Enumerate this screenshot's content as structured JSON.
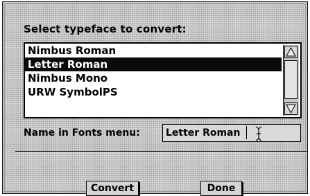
{
  "dialog": {
    "heading": "Select typeface to convert:",
    "typefaces": [
      {
        "label": "Nimbus Roman",
        "selected": false
      },
      {
        "label": "Letter Roman",
        "selected": true
      },
      {
        "label": "Nimbus Mono",
        "selected": false
      },
      {
        "label": "URW SymbolPS",
        "selected": false
      }
    ],
    "name_label": "Name in Fonts menu:",
    "name_value": "Letter Roman",
    "buttons": {
      "convert": "Convert",
      "done": "Done"
    }
  },
  "icons": {
    "scroll_up": "triangle-up-icon",
    "scroll_down": "triangle-down-icon",
    "cursor": "ibeam-cursor-icon"
  },
  "colors": {
    "selection": "#0a0a0a",
    "dialog_bg": "#c8c8c8"
  }
}
